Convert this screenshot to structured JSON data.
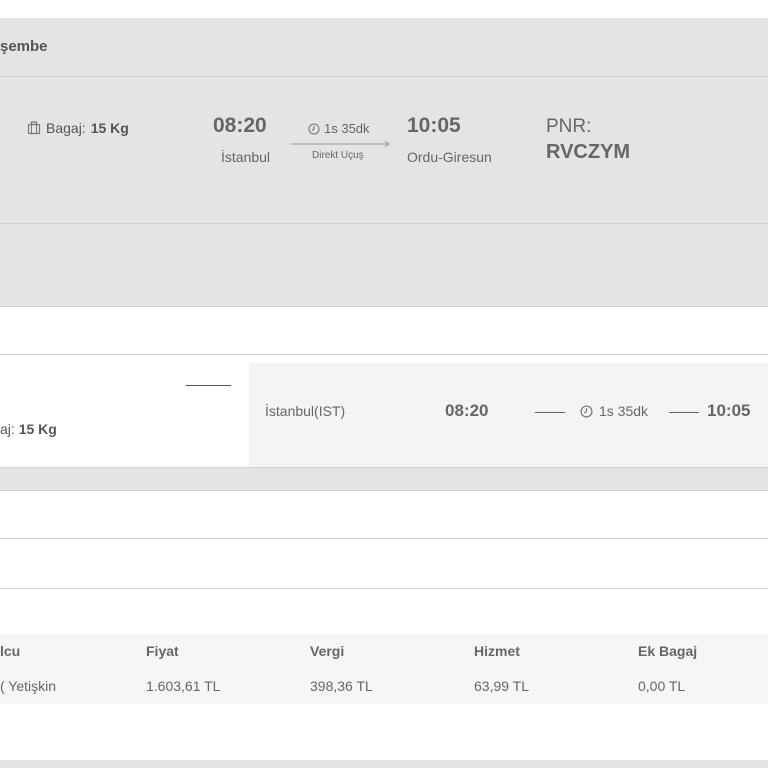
{
  "date_header": {
    "text": "şembe"
  },
  "summary": {
    "baggage_label": "Bagaj:",
    "baggage_value": "15 Kg",
    "departure_time": "08:20",
    "departure_city": "İstanbul",
    "duration": "1s 35dk",
    "flight_type": "Direkt Uçuş",
    "arrival_time": "10:05",
    "arrival_city": "Ordu-Giresun",
    "pnr_label": "PNR:",
    "pnr_code": "RVCZYM"
  },
  "detail": {
    "baggage_label": "aj:",
    "baggage_value": "15 Kg",
    "departure_airport": "İstanbul(IST)",
    "departure_time": "08:20",
    "duration": "1s 35dk",
    "arrival_time": "10:05"
  },
  "price_table": {
    "headers": [
      "lcu",
      "Fiyat",
      "Vergi",
      "Hizmet",
      "Ek Bagaj"
    ],
    "row": [
      "( Yetişkin",
      "1.603,61 TL",
      "398,36 TL",
      "63,99 TL",
      "0,00 TL"
    ]
  },
  "icons": {
    "suitcase": "suitcase-icon",
    "clock": "clock-icon",
    "arrow": "arrow-right-icon"
  }
}
